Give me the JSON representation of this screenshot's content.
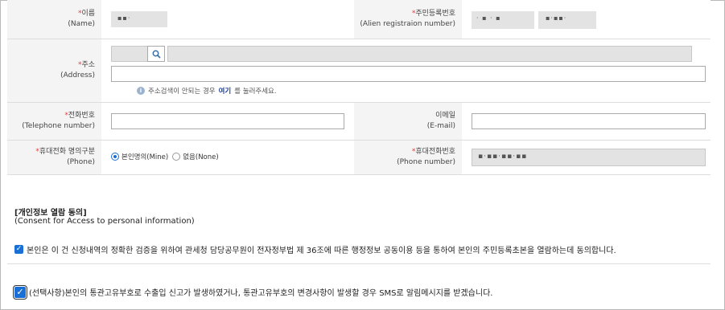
{
  "form": {
    "name": {
      "label_ko": "이름",
      "label_en": "(Name)"
    },
    "alien_no": {
      "label_ko": "주민등록번호",
      "label_en": "(Alien registraion number)"
    },
    "address": {
      "label_ko": "주소",
      "label_en": "(Address)",
      "hint_pre": "주소검색이 안되는 경우 ",
      "hint_link": "여기",
      "hint_post": "를 눌러주세요."
    },
    "phone": {
      "label_ko": "전화번호",
      "label_en": "(Telephone number)"
    },
    "email": {
      "label_ko": "이메일",
      "label_en": "(E-mail)"
    },
    "mobile_type": {
      "label_ko": "휴대전화 명의구분",
      "label_en": "(Phone)",
      "opt_mine": "본인명의(Mine)",
      "opt_none": "없음(None)",
      "selected": "mine"
    },
    "mobile_no": {
      "label_ko": "휴대전화번호",
      "label_en": "(Phone number)"
    },
    "required_mark": "*"
  },
  "consent": {
    "title": "[개인정보 열람 동의]",
    "subtitle": "(Consent for Access to personal information)",
    "agree_text": "본인은 이 건 신청내역의 정확한 검증을 위하여 관세청 담당공무원이 전자정부법 제 36조에 따른 행정정보 공동이용 등을 통하여 본인의 주민등록초본을 열람하는데 동의합니다.",
    "sms_text": "(선택사항)본인의 통관고유부호로 수출입 신고가 발생하였거나, 통관고유부호의 변경사항이 발생할 경우 SMS로 알림메시지를 받겠습니다.",
    "checkmark": "✓"
  },
  "icons": {
    "search": "search-icon",
    "info": "i"
  },
  "colors": {
    "accent": "#1a6fd6",
    "required": "#e03c3c",
    "link": "#1a3ea0",
    "label_bg": "#f4f4f4"
  }
}
